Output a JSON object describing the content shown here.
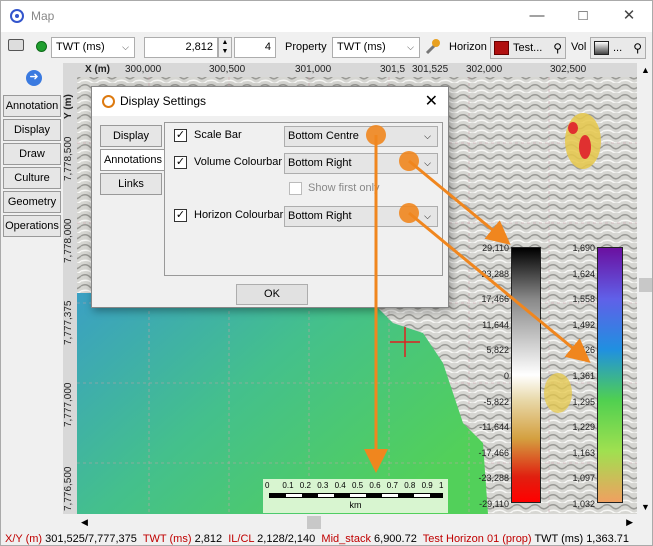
{
  "window": {
    "title": "Map"
  },
  "toolbar": {
    "domain_value": "TWT (ms)",
    "time_value": "2,812",
    "step_value": "4",
    "property_label": "Property",
    "property_value": "TWT (ms)",
    "horizon_label": "Horizon",
    "horizon_value": "Test...",
    "vol_label": "Vol",
    "vol_value": "..."
  },
  "sidebar": {
    "tabs": [
      "Annotation",
      "Display",
      "Draw",
      "Culture",
      "Geometry",
      "Operations"
    ]
  },
  "axes": {
    "x_title": "X (m)",
    "y_title": "Y (m)",
    "x_ticks": [
      "300,000",
      "300,500",
      "301,000",
      "301,5",
      "301,525",
      "302,000",
      "302,500"
    ],
    "y_ticks": [
      "7,778,500",
      "7,778,000",
      "7,777,375",
      "7,777,000",
      "7,776,500"
    ]
  },
  "dialog": {
    "title": "Display Settings",
    "tabs": [
      "Display",
      "Annotations",
      "Links"
    ],
    "active_tab": "Annotations",
    "rows": [
      {
        "label": "Scale Bar",
        "checked": true,
        "value": "Bottom Centre"
      },
      {
        "label": "Volume Colourbar",
        "checked": true,
        "value": "Bottom Right"
      },
      {
        "label": "Show first only",
        "checked": false,
        "value": ""
      },
      {
        "label": "Horizon Colourbar",
        "checked": true,
        "value": "Bottom Right"
      }
    ],
    "ok_label": "OK"
  },
  "volume_colourbar": {
    "labels": [
      "29,110",
      "23,288",
      "17,466",
      "11,644",
      "5,822",
      "0",
      "-5,822",
      "-11,644",
      "-17,466",
      "-23,288",
      "-29,110"
    ]
  },
  "horizon_colourbar": {
    "labels": [
      "1,690",
      "1,624",
      "1,558",
      "1,492",
      "1,426",
      "1,361",
      "1,295",
      "1,229",
      "1,163",
      "1,097",
      "1,032"
    ]
  },
  "scale_bar": {
    "ticks": [
      "0",
      "0.1",
      "0.2",
      "0.3",
      "0.4",
      "0.5",
      "0.6",
      "0.7",
      "0.8",
      "0.9",
      "1"
    ],
    "unit": "km"
  },
  "status": {
    "xy_label": "X/Y (m)",
    "xy_value": "301,525/7,777,375",
    "twt_label": "TWT (ms)",
    "twt_value": "2,812",
    "ilcl_label": "IL/CL",
    "ilcl_value": "2,128/2,140",
    "mid_label": "Mid_stack",
    "mid_value": "6,900.72",
    "hz_label": "Test Horizon 01 (prop)",
    "hz_twt_label": "TWT (ms)",
    "hz_twt_value": "1,363.71"
  },
  "colors": {
    "accent_orange": "#f0861e",
    "cursor_red": "#e02020",
    "status_red": "#c00000"
  }
}
